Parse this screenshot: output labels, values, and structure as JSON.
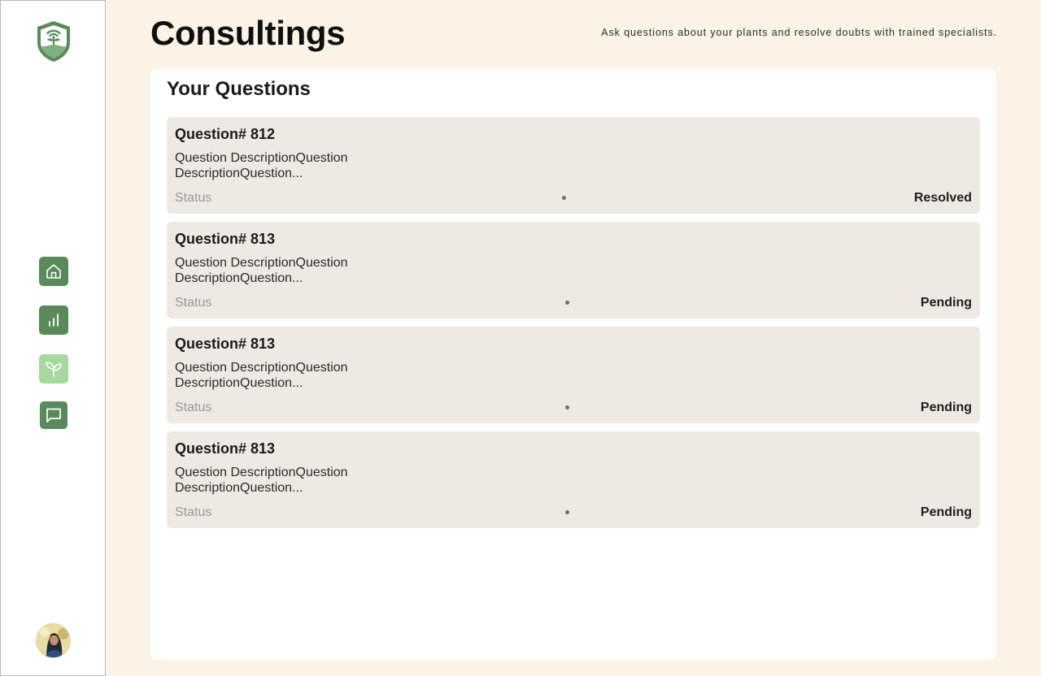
{
  "header": {
    "title": "Consultings",
    "subtitle": "Ask questions about your plants and resolve doubts with trained specialists."
  },
  "sidebar": {
    "logo_icon": "shield-sprout-logo",
    "items": [
      {
        "name": "home",
        "icon": "home-icon",
        "active": false
      },
      {
        "name": "analytics",
        "icon": "bar-chart-icon",
        "active": false
      },
      {
        "name": "plants",
        "icon": "sprout-icon",
        "active": true
      },
      {
        "name": "consultings",
        "icon": "message-icon",
        "active": false
      }
    ],
    "avatar_icon": "user-avatar"
  },
  "panel": {
    "title": "Your Questions"
  },
  "questions": [
    {
      "title": "Question# 812",
      "description": "Question DescriptionQuestion DescriptionQuestion...",
      "status_label": "Status",
      "status": "Resolved"
    },
    {
      "title": "Question# 813",
      "description": "Question DescriptionQuestion DescriptionQuestion...",
      "status_label": "Status",
      "status": "Pending"
    },
    {
      "title": "Question# 813",
      "description": "Question DescriptionQuestion DescriptionQuestion...",
      "status_label": "Status",
      "status": "Pending"
    },
    {
      "title": "Question# 813",
      "description": "Question DescriptionQuestion DescriptionQuestion...",
      "status_label": "Status",
      "status": "Pending"
    }
  ],
  "colors": {
    "background": "#faf3e6",
    "brand_green": "#5a8a5c",
    "active_green": "#a6d8a0",
    "card": "#eeeae3"
  }
}
